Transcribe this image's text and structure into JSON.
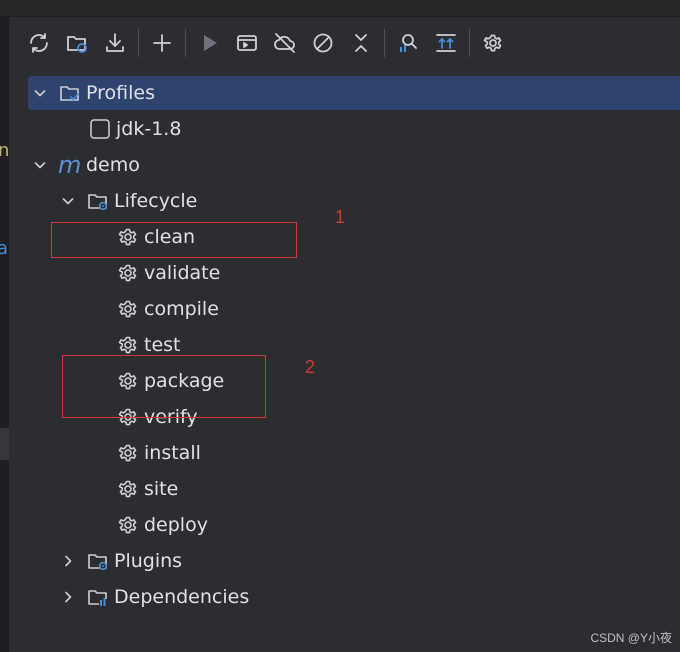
{
  "toolbar": {
    "buttons": [
      {
        "icon": "reload-icon"
      },
      {
        "icon": "generate-sources-icon"
      },
      {
        "icon": "download-icon"
      },
      {
        "icon": "add-icon"
      },
      {
        "icon": "run-icon"
      },
      {
        "icon": "execute-goal-icon"
      },
      {
        "icon": "offline-icon"
      },
      {
        "icon": "skip-tests-icon"
      },
      {
        "icon": "collapse-all-icon"
      },
      {
        "icon": "show-dependencies-icon"
      },
      {
        "icon": "analyze-icon"
      },
      {
        "icon": "settings-icon"
      }
    ]
  },
  "tree": {
    "profiles": {
      "label": "Profiles"
    },
    "profile_items": [
      {
        "label": "jdk-1.8",
        "checked": false
      }
    ],
    "project": {
      "label": "demo",
      "icon_text": "m"
    },
    "lifecycle": {
      "label": "Lifecycle",
      "goals": [
        {
          "label": "clean"
        },
        {
          "label": "validate"
        },
        {
          "label": "compile"
        },
        {
          "label": "test"
        },
        {
          "label": "package"
        },
        {
          "label": "verify"
        },
        {
          "label": "install"
        },
        {
          "label": "site"
        },
        {
          "label": "deploy"
        }
      ]
    },
    "plugins": {
      "label": "Plugins"
    },
    "dependencies": {
      "label": "Dependencies"
    }
  },
  "annotations": [
    {
      "number": "1"
    },
    {
      "number": "2"
    }
  ],
  "editor_gutter": {
    "char_1": "n",
    "char_2": "a"
  },
  "watermark": "CSDN @Y小夜",
  "colors": {
    "background": "#2b2d30",
    "selection": "#2e436e",
    "annotation": "#d23a3a",
    "maven_accent": "#5b8fd6"
  }
}
